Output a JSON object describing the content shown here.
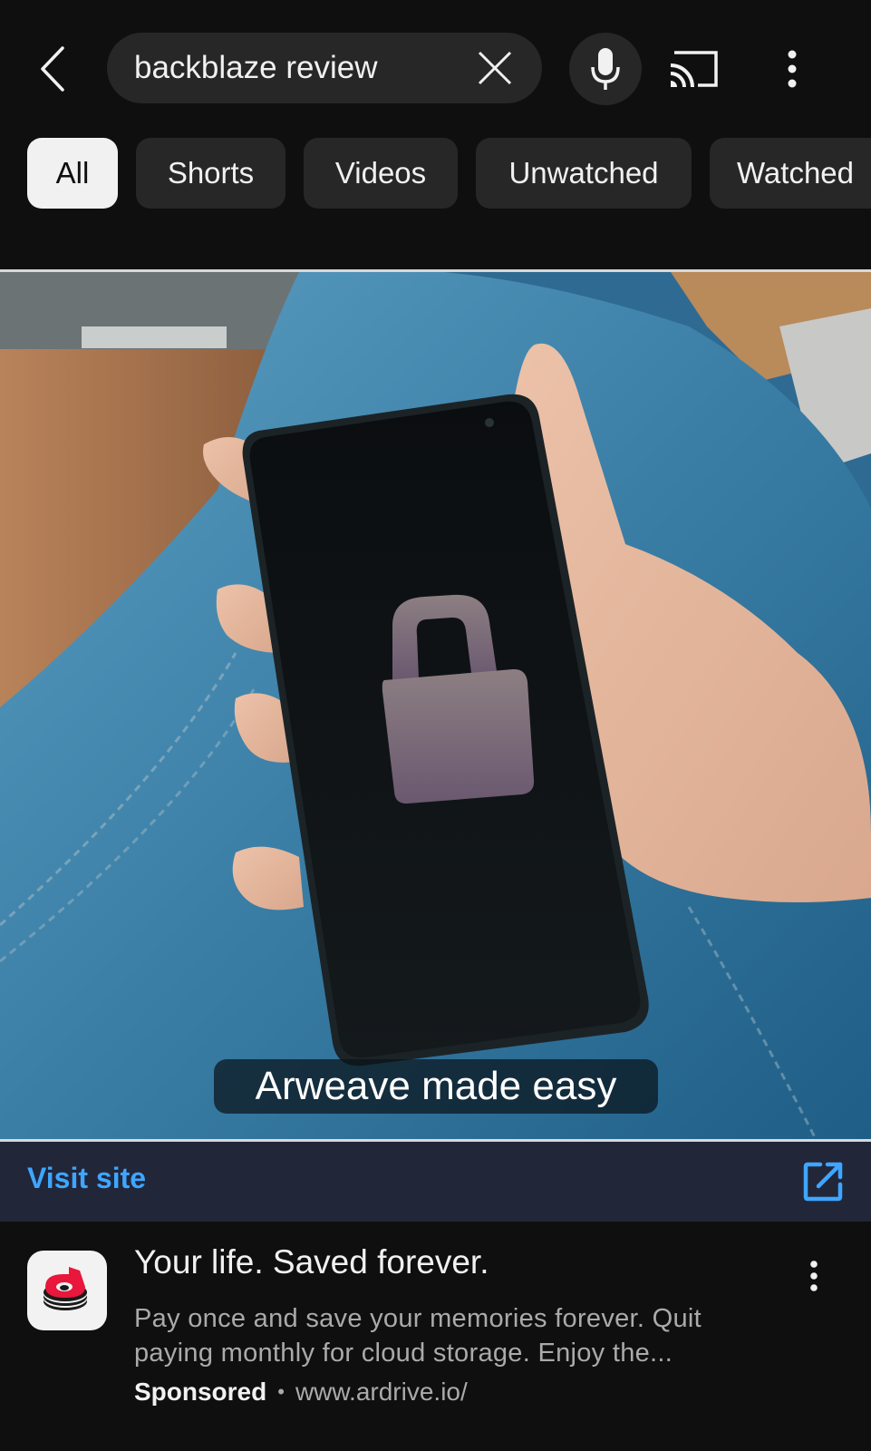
{
  "header": {
    "search_query": "backblaze review",
    "icons": {
      "back": "chevron-left-icon",
      "clear": "close-icon",
      "mic": "microphone-icon",
      "cast": "cast-icon",
      "more": "more-vertical-icon"
    }
  },
  "filters": {
    "chips": [
      {
        "label": "All",
        "active": true
      },
      {
        "label": "Shorts",
        "active": false
      },
      {
        "label": "Videos",
        "active": false
      },
      {
        "label": "Unwatched",
        "active": false
      },
      {
        "label": "Watched",
        "active": false
      }
    ]
  },
  "ad_video": {
    "caption": "Arweave made easy",
    "visit_site_label": "Visit site",
    "visit_icon": "open-in-new-icon"
  },
  "ad_info": {
    "title": "Your life. Saved forever.",
    "description": "Pay once and save your memories forever. Quit paying monthly for cloud storage. Enjoy the...",
    "sponsored_label": "Sponsored",
    "separator": "•",
    "url": "www.ardrive.io/",
    "logo": "ardrive-logo"
  },
  "colors": {
    "background": "#0f0f0f",
    "chip": "#272727",
    "chip_active": "#f1f1f1",
    "link_blue": "#3ea6ff",
    "visit_bar": "#222639",
    "secondary_text": "#aaaaaa",
    "logo_red": "#e8173b"
  }
}
